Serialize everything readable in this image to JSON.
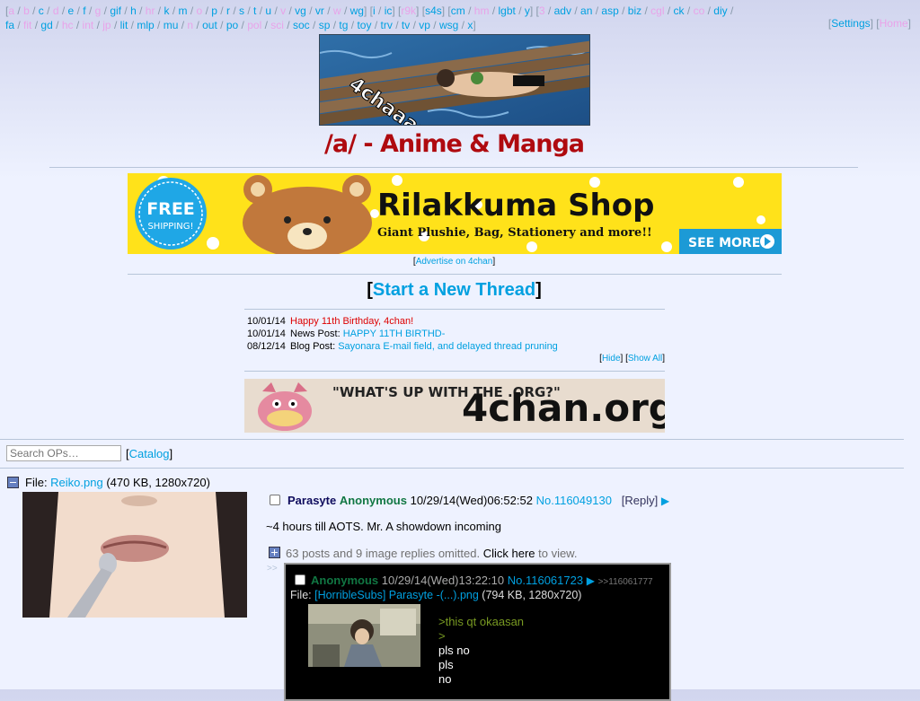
{
  "top_nav": {
    "items": [
      {
        "label": "a",
        "sfw": false
      },
      {
        "label": "b",
        "sfw": false
      },
      {
        "label": "c",
        "sfw": true
      },
      {
        "label": "d",
        "sfw": false
      },
      {
        "label": "e",
        "sfw": true
      },
      {
        "label": "f",
        "sfw": true
      },
      {
        "label": "g",
        "sfw": false
      },
      {
        "label": "gif",
        "sfw": true
      },
      {
        "label": "h",
        "sfw": true
      },
      {
        "label": "hr",
        "sfw": false
      },
      {
        "label": "k",
        "sfw": true
      },
      {
        "label": "m",
        "sfw": true
      },
      {
        "label": "o",
        "sfw": false
      },
      {
        "label": "p",
        "sfw": true
      },
      {
        "label": "r",
        "sfw": true
      },
      {
        "label": "s",
        "sfw": true
      },
      {
        "label": "t",
        "sfw": true
      },
      {
        "label": "u",
        "sfw": true
      },
      {
        "label": "v",
        "sfw": false
      },
      {
        "label": "vg",
        "sfw": true
      },
      {
        "label": "vr",
        "sfw": true
      },
      {
        "label": "w",
        "sfw": false
      },
      {
        "label": "wg",
        "sfw": true
      },
      {
        "label": "i",
        "sfw": true,
        "group_start": true
      },
      {
        "label": "ic",
        "sfw": true
      },
      {
        "label": "r9k",
        "sfw": false,
        "group_start": true,
        "solo": true
      },
      {
        "label": "s4s",
        "sfw": true,
        "group_start": true,
        "solo": true
      },
      {
        "label": "cm",
        "sfw": true,
        "group_start": true
      },
      {
        "label": "hm",
        "sfw": false
      },
      {
        "label": "lgbt",
        "sfw": true
      },
      {
        "label": "y",
        "sfw": true
      },
      {
        "label": "3",
        "sfw": false,
        "group_start": true
      },
      {
        "label": "adv",
        "sfw": true
      },
      {
        "label": "an",
        "sfw": true
      },
      {
        "label": "asp",
        "sfw": true
      },
      {
        "label": "biz",
        "sfw": true
      },
      {
        "label": "cgl",
        "sfw": false
      },
      {
        "label": "ck",
        "sfw": true
      },
      {
        "label": "co",
        "sfw": false
      },
      {
        "label": "diy",
        "sfw": true
      },
      {
        "label": "fa",
        "sfw": true
      },
      {
        "label": "fit",
        "sfw": false
      },
      {
        "label": "gd",
        "sfw": true
      },
      {
        "label": "hc",
        "sfw": false
      },
      {
        "label": "int",
        "sfw": false
      },
      {
        "label": "jp",
        "sfw": false
      },
      {
        "label": "lit",
        "sfw": true
      },
      {
        "label": "mlp",
        "sfw": true
      },
      {
        "label": "mu",
        "sfw": true
      },
      {
        "label": "n",
        "sfw": false
      },
      {
        "label": "out",
        "sfw": true
      },
      {
        "label": "po",
        "sfw": true
      },
      {
        "label": "pol",
        "sfw": false
      },
      {
        "label": "sci",
        "sfw": false
      },
      {
        "label": "soc",
        "sfw": true
      },
      {
        "label": "sp",
        "sfw": true
      },
      {
        "label": "tg",
        "sfw": true
      },
      {
        "label": "toy",
        "sfw": true
      },
      {
        "label": "trv",
        "sfw": true
      },
      {
        "label": "tv",
        "sfw": true
      },
      {
        "label": "vp",
        "sfw": true
      },
      {
        "label": "wsg",
        "sfw": true
      },
      {
        "label": "x",
        "sfw": true
      }
    ],
    "settings_label": "Settings",
    "home_label": "Home"
  },
  "banner": {
    "caption": "4chaaaan"
  },
  "board_title": "/a/ - Anime & Manga",
  "ad": {
    "badge_line1": "FREE",
    "badge_line2": "SHIPPING!",
    "headline": "Rilakkuma Shop",
    "subline": "Giant Plushie, Bag, Stationery and more!!",
    "cta": "SEE MORE!!",
    "advertise_label": "Advertise on 4chan"
  },
  "post_form_label": "Start a New Thread",
  "news": [
    {
      "date": "10/01/14",
      "prefix": "",
      "text": "Happy 11th Birthday, 4chan!",
      "style": "red"
    },
    {
      "date": "10/01/14",
      "prefix": "News Post: ",
      "text": "HAPPY 11TH BIRTHD-",
      "style": "blue"
    },
    {
      "date": "08/12/14",
      "prefix": "Blog Post: ",
      "text": "Sayonara E-mail field, and delayed thread pruning",
      "style": "blue"
    }
  ],
  "news_controls": {
    "hide": "Hide",
    "show_all": "Show All"
  },
  "org_banner": {
    "quote": "\"WHAT'S UP WITH THE .ORG?\"",
    "site": "4chan.org"
  },
  "search": {
    "placeholder": "Search OPs…"
  },
  "catalog_label": "Catalog",
  "op": {
    "file_prefix": "File: ",
    "file_name": "Reiko.png",
    "file_meta": " (470 KB, 1280x720)",
    "subject": "Parasyte",
    "name": "Anonymous",
    "datetime": "10/29/14(Wed)06:52:52",
    "number": "No.116049130",
    "reply_label": "Reply",
    "text": "~4 hours till AOTS. Mr. A showdown incoming"
  },
  "omitted": {
    "text": "63 posts and 9 image replies omitted.",
    "click_here": "Click here",
    "suffix": " to view."
  },
  "reply": {
    "side_arrows": ">>",
    "name": "Anonymous",
    "datetime": "10/29/14(Wed)13:22:10",
    "number": "No.116061723",
    "backlink": ">>116061777",
    "file_prefix": "File: ",
    "file_name": "[HorribleSubs] Parasyte -(...).png",
    "file_meta": " (794 KB, 1280x720)",
    "lines": [
      {
        "text": ">this qt okaasan",
        "quote": true
      },
      {
        "text": ">",
        "quote": true
      },
      {
        "text": "pls no",
        "quote": false
      },
      {
        "text": "pls",
        "quote": false
      },
      {
        "text": "no",
        "quote": false
      }
    ]
  },
  "colors": {
    "background": "#eef2ff",
    "title": "#af0a0f",
    "link": "#00a0e0",
    "name": "#117743",
    "subject": "#0f0c5d",
    "quote": "#789922"
  }
}
